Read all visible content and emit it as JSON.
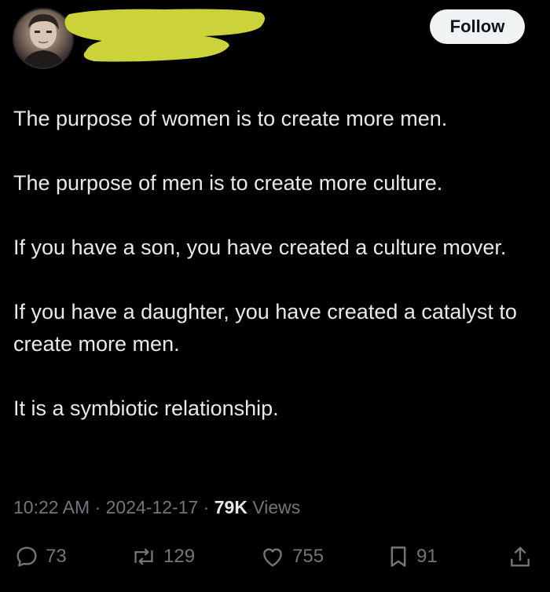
{
  "header": {
    "follow_label": "Follow"
  },
  "tweet": {
    "paragraphs": [
      "The purpose of women is to create more men.",
      "The purpose of men is to create more culture.",
      "If you have a son, you have created a culture mover.",
      "If you have a daughter, you have created a catalyst to create more men.",
      "It is a symbiotic relationship."
    ]
  },
  "meta": {
    "time": "10:22 AM",
    "separator": " · ",
    "date": "2024-12-17",
    "views_count": "79K",
    "views_label": " Views"
  },
  "actions": {
    "replies": "73",
    "reposts": "129",
    "likes": "755",
    "bookmarks": "91"
  },
  "icons": {
    "reply": "speech-bubble",
    "repost": "repost-arrows",
    "like": "heart",
    "bookmark": "bookmark",
    "share": "share-upload"
  },
  "colors": {
    "background": "#000000",
    "text": "#e7e9ea",
    "secondary": "#71767b",
    "redaction": "#ccd23a",
    "follow_bg": "#eff3f4"
  }
}
